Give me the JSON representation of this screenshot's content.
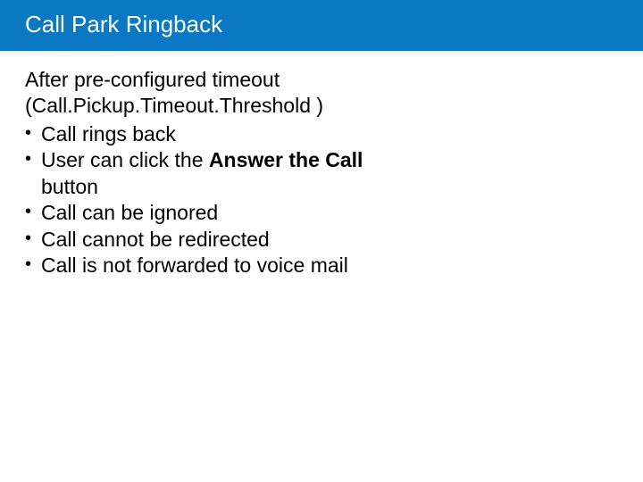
{
  "title": "Call Park Ringback",
  "intro_line1": "After pre-configured timeout",
  "intro_line2": "(Call.Pickup.Timeout.Threshold )",
  "bullets": {
    "b0": "Call rings back",
    "b1_pre": "User can click the ",
    "b1_bold": "Answer the Call",
    "b1_post": " button",
    "b2": "Call can be ignored",
    "b3": "Call cannot be redirected",
    "b4": "Call is not forwarded to voice mail"
  }
}
